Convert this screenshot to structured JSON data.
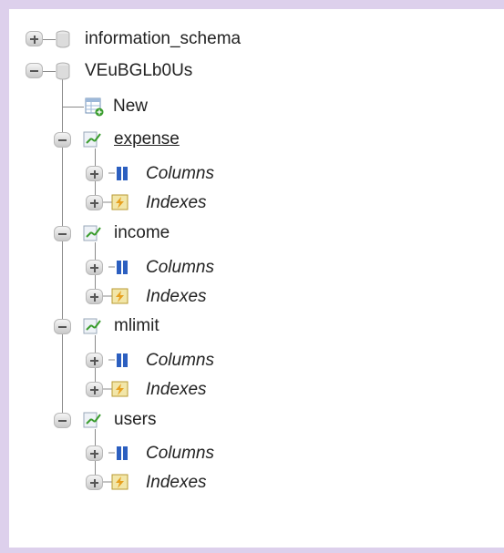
{
  "tree": {
    "databases": [
      {
        "name": "information_schema",
        "expanded": false
      },
      {
        "name": "VEuBGLb0Us",
        "expanded": true
      }
    ],
    "new_label": "New",
    "tables": [
      {
        "name": "expense",
        "columns_label": "Columns",
        "indexes_label": "Indexes"
      },
      {
        "name": "income",
        "columns_label": "Columns",
        "indexes_label": "Indexes"
      },
      {
        "name": "mlimit",
        "columns_label": "Columns",
        "indexes_label": "Indexes"
      },
      {
        "name": "users",
        "columns_label": "Columns",
        "indexes_label": "Indexes"
      }
    ]
  },
  "icons": {
    "database": "database-icon",
    "new": "new-table-icon",
    "table": "table-icon",
    "columns": "columns-icon",
    "indexes": "indexes-icon"
  },
  "colors": {
    "frame": "#ddd0ec",
    "tree_line": "#8a8a8a",
    "column_bar": "#2c5fc0"
  }
}
